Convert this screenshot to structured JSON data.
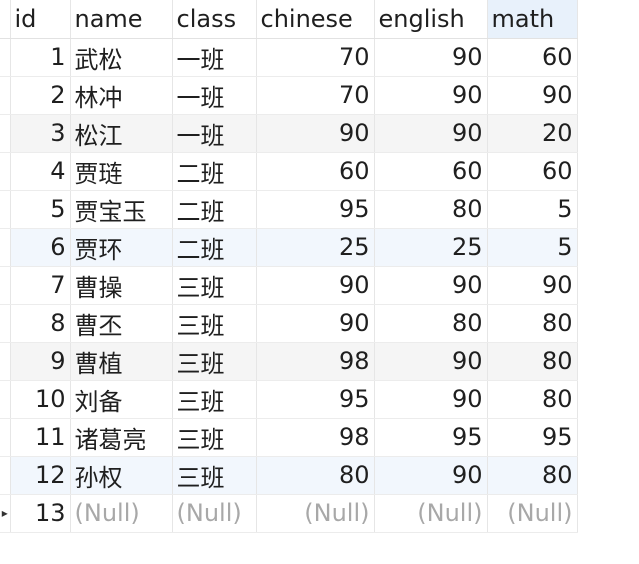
{
  "table": {
    "columns": [
      "id",
      "name",
      "class",
      "chinese",
      "english",
      "math"
    ],
    "sorted_column": "math",
    "rows": [
      [
        "1",
        "武松",
        "一班",
        "70",
        "90",
        "60"
      ],
      [
        "2",
        "林冲",
        "一班",
        "70",
        "90",
        "90"
      ],
      [
        "3",
        "松江",
        "一班",
        "90",
        "90",
        "20"
      ],
      [
        "4",
        "贾琏",
        "二班",
        "60",
        "60",
        "60"
      ],
      [
        "5",
        "贾宝玉",
        "二班",
        "95",
        "80",
        "5"
      ],
      [
        "6",
        "贾环",
        "二班",
        "25",
        "25",
        "5"
      ],
      [
        "7",
        "曹操",
        "三班",
        "90",
        "90",
        "90"
      ],
      [
        "8",
        "曹丕",
        "三班",
        "90",
        "80",
        "80"
      ],
      [
        "9",
        "曹植",
        "三班",
        "98",
        "90",
        "80"
      ],
      [
        "10",
        "刘备",
        "三班",
        "95",
        "90",
        "80"
      ],
      [
        "11",
        "诸葛亮",
        "三班",
        "98",
        "95",
        "95"
      ],
      [
        "12",
        "孙权",
        "三班",
        "80",
        "90",
        "80"
      ]
    ],
    "new_row": [
      "13",
      "(Null)",
      "(Null)",
      "(Null)",
      "(Null)",
      "(Null)"
    ],
    "current_row_marker": "▸"
  }
}
